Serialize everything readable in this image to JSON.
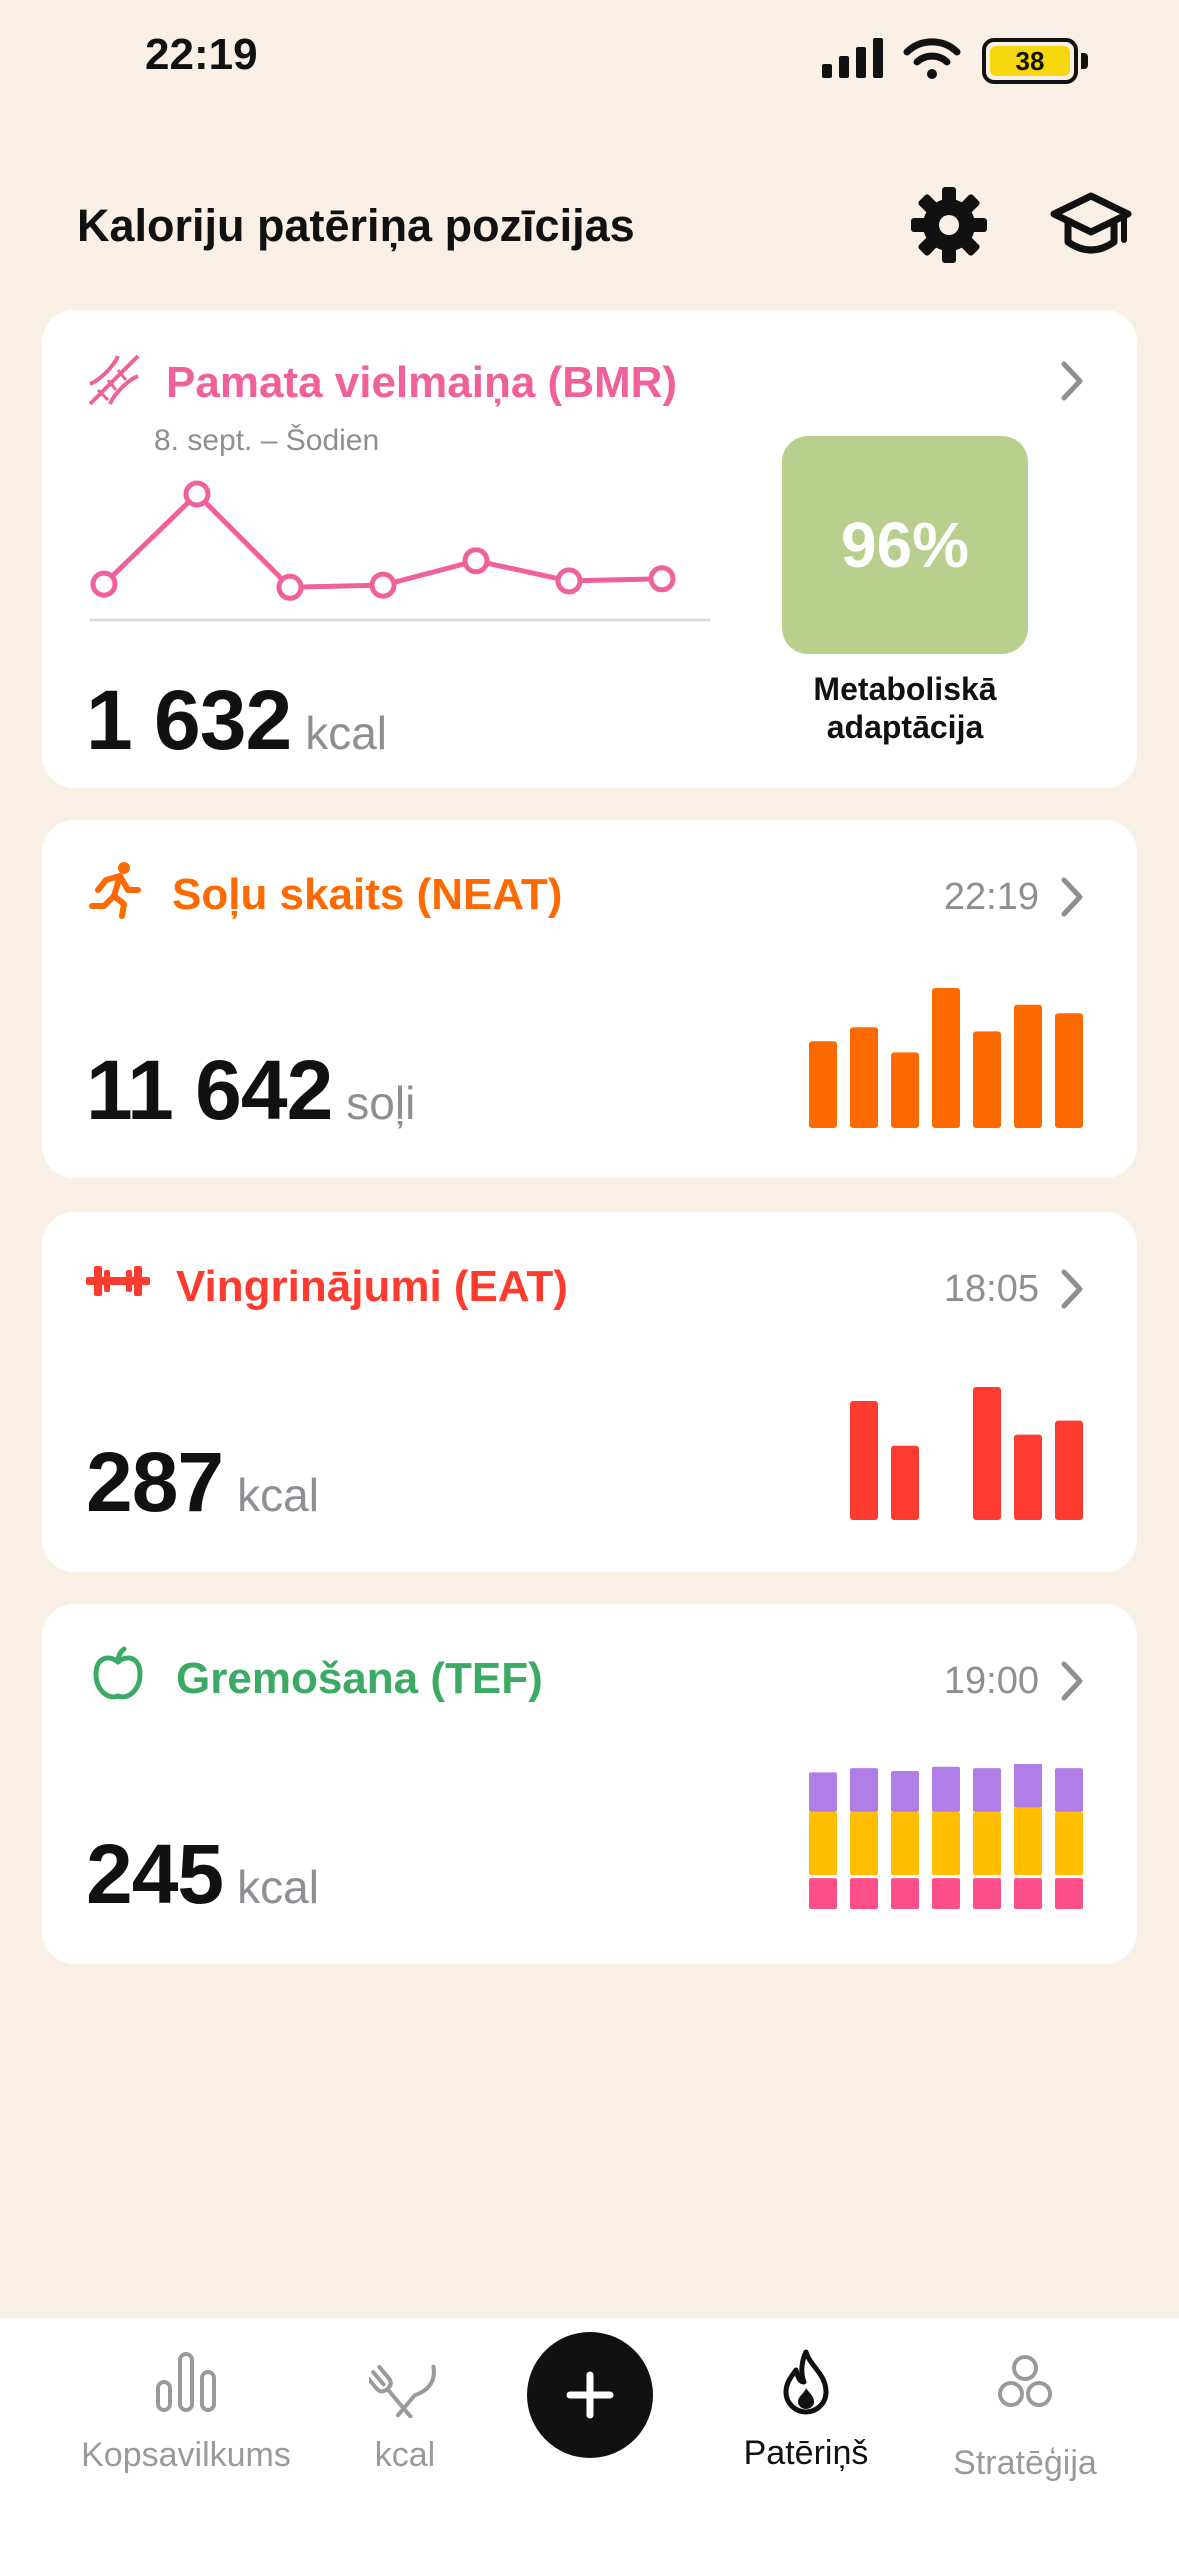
{
  "status_bar": {
    "time": "22:19",
    "battery": "38"
  },
  "header": {
    "title": "Kaloriju patēriņa pozīcijas"
  },
  "cards": {
    "bmr": {
      "title": "Pamata vielmaiņa (BMR)",
      "subtitle": "8. sept. – Šodien",
      "value": "1 632",
      "unit": "kcal",
      "adaptation_value": "96%",
      "adaptation_label": "Metaboliskā adaptācija",
      "color": "#f0609a"
    },
    "neat": {
      "title": "Soļu skaits (NEAT)",
      "time": "22:19",
      "value": "11 642",
      "unit": "soļi",
      "color": "#ff6a00"
    },
    "eat": {
      "title": "Vingrinājumi (EAT)",
      "time": "18:05",
      "value": "287",
      "unit": "kcal",
      "color": "#ff3b30"
    },
    "tef": {
      "title": "Gremošana (TEF)",
      "time": "19:00",
      "value": "245",
      "unit": "kcal",
      "color": "#3aaa64"
    }
  },
  "chart_data": [
    {
      "type": "line",
      "values": [
        0.15,
        1.0,
        0.12,
        0.14,
        0.37,
        0.18,
        0.2
      ],
      "color": "#f0609a"
    },
    {
      "type": "bar",
      "values": [
        0.62,
        0.72,
        0.54,
        1.0,
        0.69,
        0.88,
        0.82
      ],
      "color": "#ff6a00"
    },
    {
      "type": "bar",
      "values": [
        0.85,
        0.53,
        0,
        0.95,
        0.61,
        0.71
      ],
      "color": "#ff3b30"
    },
    {
      "type": "bar",
      "stacked": true,
      "series": [
        {
          "values": [
            0.24,
            0.24,
            0.24,
            0.24,
            0.24,
            0.24,
            0.24
          ],
          "color": "#ff4f8b"
        },
        {
          "values": [
            0.47,
            0.47,
            0.47,
            0.47,
            0.47,
            0.5,
            0.47
          ],
          "color": "#ffbf00"
        },
        {
          "values": [
            0.28,
            0.31,
            0.29,
            0.32,
            0.31,
            0.33,
            0.31
          ],
          "color": "#b07ee6"
        }
      ]
    }
  ],
  "tab_bar": {
    "items": [
      {
        "label": "Kopsavilkums"
      },
      {
        "label": "kcal"
      },
      {
        "label": "Patēriņš"
      },
      {
        "label": "Stratēģija"
      }
    ]
  }
}
